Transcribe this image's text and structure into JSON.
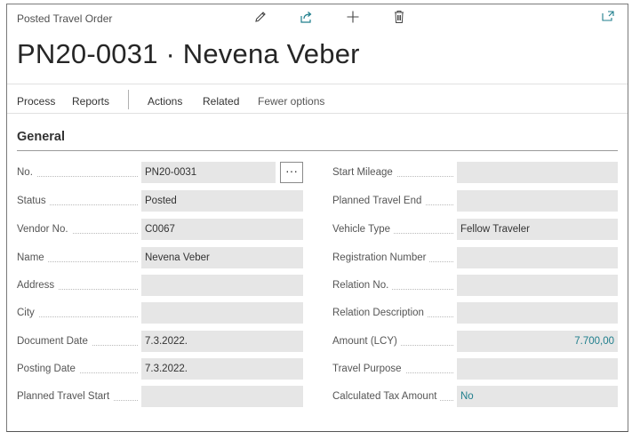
{
  "header": {
    "page_type": "Posted Travel Order",
    "title": "PN20-0031 · Nevena Veber"
  },
  "actions": {
    "process": "Process",
    "reports": "Reports",
    "actions": "Actions",
    "related": "Related",
    "fewer_options": "Fewer options"
  },
  "section": {
    "title": "General"
  },
  "left_fields": [
    {
      "label": "No.",
      "value": "PN20-0031"
    },
    {
      "label": "Status",
      "value": "Posted"
    },
    {
      "label": "Vendor No.",
      "value": "C0067"
    },
    {
      "label": "Name",
      "value": "Nevena Veber"
    },
    {
      "label": "Address",
      "value": ""
    },
    {
      "label": "City",
      "value": ""
    },
    {
      "label": "Document Date",
      "value": "7.3.2022."
    },
    {
      "label": "Posting Date",
      "value": "7.3.2022."
    },
    {
      "label": "Planned Travel Start",
      "value": ""
    }
  ],
  "right_fields": [
    {
      "label": "Start Mileage",
      "value": ""
    },
    {
      "label": "Planned Travel End",
      "value": ""
    },
    {
      "label": "Vehicle Type",
      "value": "Fellow Traveler"
    },
    {
      "label": "Registration Number",
      "value": ""
    },
    {
      "label": "Relation No.",
      "value": ""
    },
    {
      "label": "Relation Description",
      "value": ""
    },
    {
      "label": "Amount (LCY)",
      "value": "7.700,00"
    },
    {
      "label": "Travel Purpose",
      "value": ""
    },
    {
      "label": "Calculated Tax Amount",
      "value": "No"
    }
  ],
  "lookup_button": "···",
  "icons": {
    "edit": "pencil-icon",
    "share": "share-icon",
    "new": "plus-icon",
    "delete": "trash-icon",
    "expand": "pop-out-icon"
  },
  "colors": {
    "link": "#1f7e8c",
    "field_bg": "#e6e6e6"
  }
}
